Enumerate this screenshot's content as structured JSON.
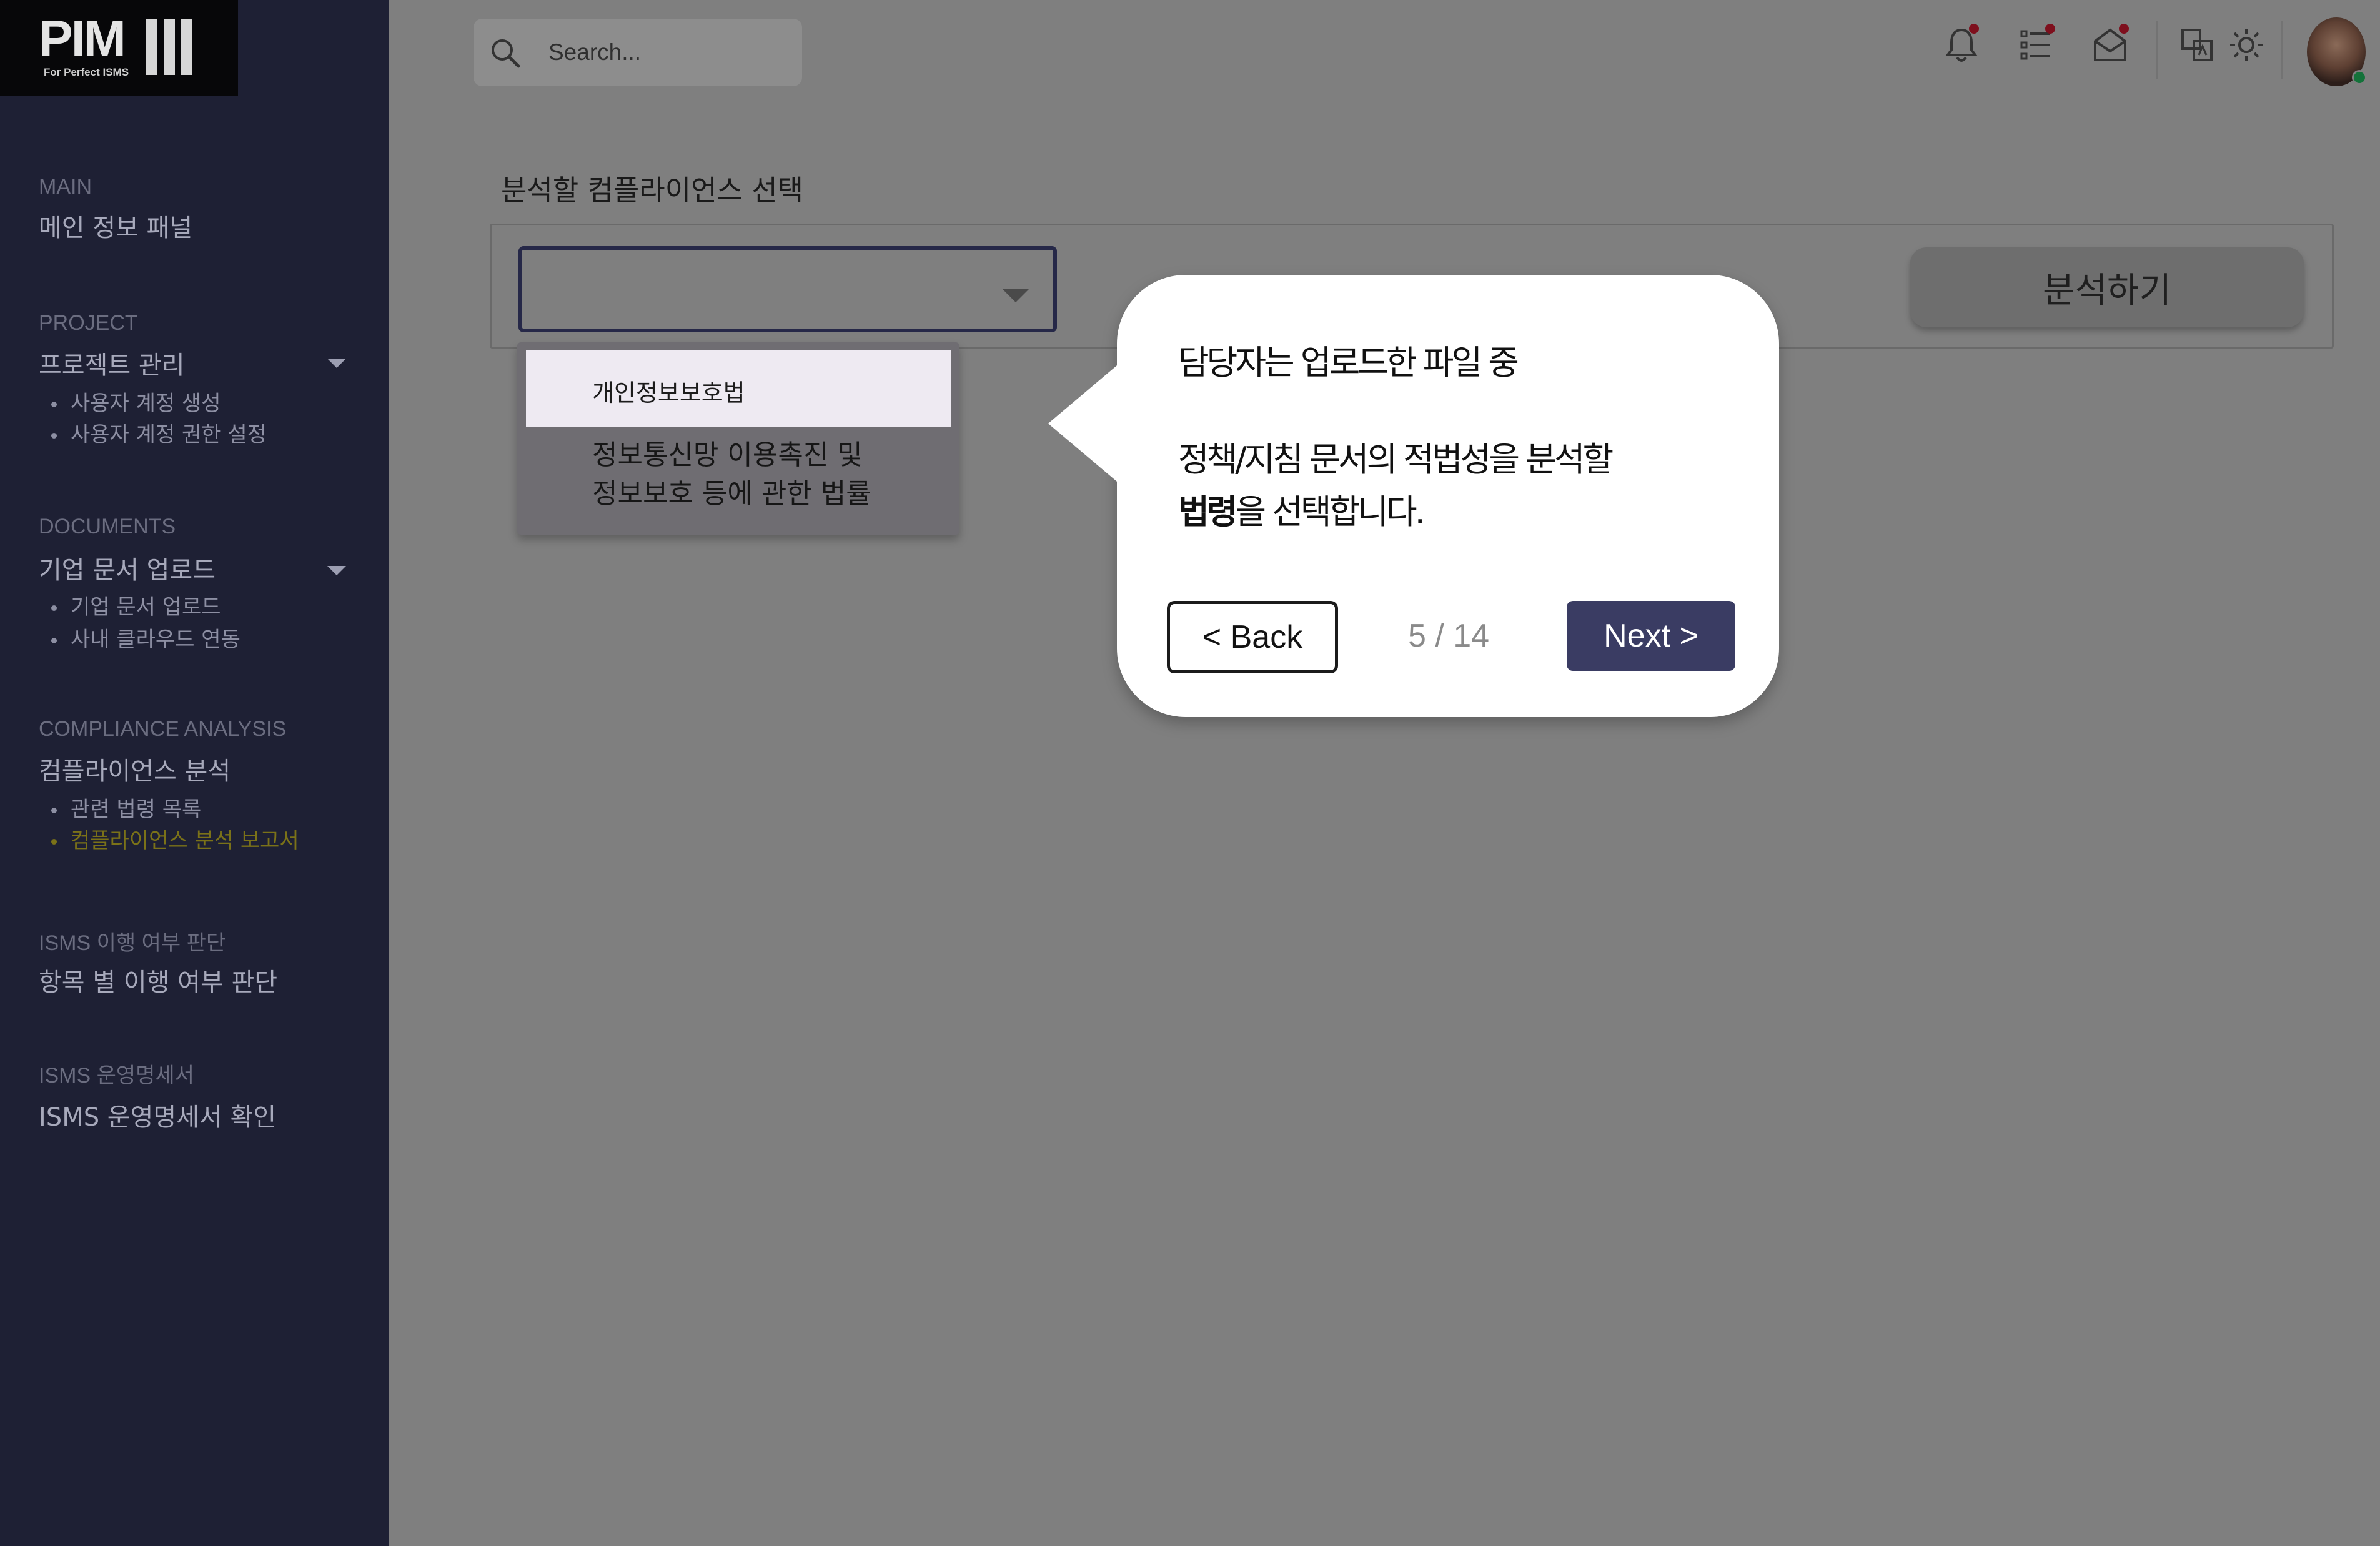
{
  "logo": {
    "title": "PIM",
    "subtitle": "For Perfect ISMS"
  },
  "sidebar": {
    "main": {
      "label": "MAIN",
      "title": "메인 정보 패널"
    },
    "project": {
      "label": "PROJECT",
      "title": "프로젝트 관리",
      "items": [
        "사용자 계정 생성",
        "사용자 계정 권한 설정"
      ]
    },
    "documents": {
      "label": "DOCUMENTS",
      "title": "기업 문서 업로드",
      "items": [
        "기업 문서 업로드",
        "사내 클라우드 연동"
      ]
    },
    "compliance": {
      "label": "COMPLIANCE ANALYSIS",
      "title": "컴플라이언스 분석",
      "items": [
        "관련 법령 목록",
        "컴플라이언스 분석 보고서"
      ],
      "active_item": "컴플라이언스 분석 보고서",
      "active_color": "#7b7218"
    },
    "isms_check": {
      "label": "ISMS 이행 여부 판단",
      "title": "항목 별 이행 여부 판단"
    },
    "isms_spec": {
      "label": "ISMS 운영명세서",
      "title": "ISMS 운영명세서 확인"
    }
  },
  "header": {
    "search": {
      "placeholder": "Search..."
    },
    "icons": [
      "bell-icon",
      "list-icon",
      "mail-icon",
      "translate-icon",
      "sun-icon"
    ],
    "badge_color": "#7e0f1d",
    "status_color": "#14723a"
  },
  "main": {
    "select_label": "분석할 컴플라이언스 선택",
    "select_value": "",
    "options": [
      "개인정보보호법",
      "정보통신망 이용촉진 및\n정보보호 등에 관한 법률"
    ],
    "analyze_button": "분석하기"
  },
  "tooltip": {
    "line1": "담당자는 업로드한 파일 중",
    "line2": "정책/지침 문서의 적법성을 분석할",
    "line3_bold": "법령",
    "line3_rest": "을 선택합니다.",
    "back_button": "< Back",
    "step": "5 / 14",
    "next_button": "Next >"
  },
  "colors": {
    "sidebar": "#1e2034",
    "accent": "#3a3c63",
    "overlay": "#7f7f7f"
  }
}
